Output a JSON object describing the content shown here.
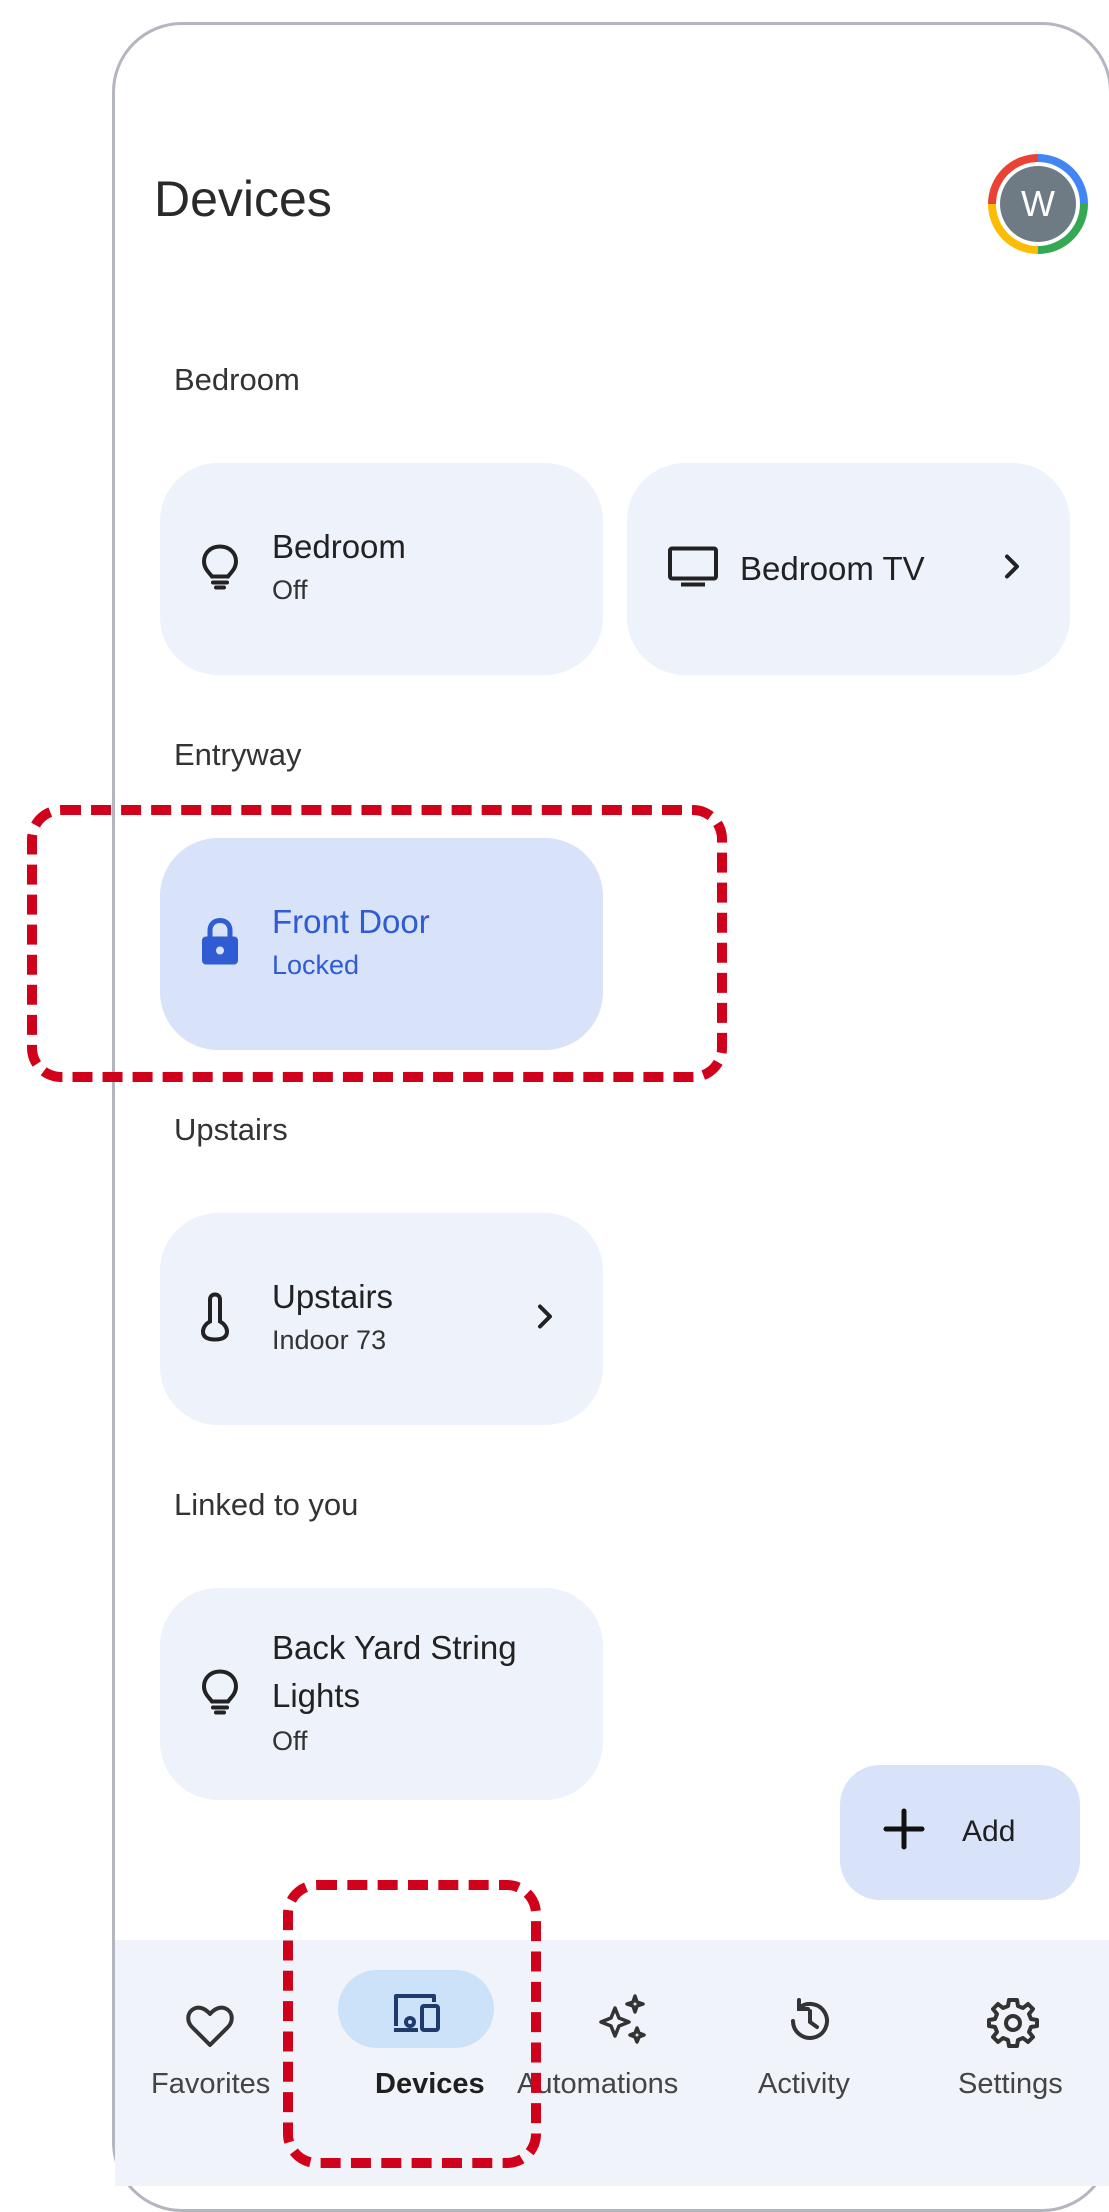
{
  "header": {
    "title": "Devices",
    "avatar_initial": "W"
  },
  "sections": {
    "bedroom": {
      "label": "Bedroom",
      "devices": [
        {
          "name": "Bedroom",
          "status": "Off",
          "icon": "lightbulb-icon"
        },
        {
          "name": "Bedroom TV",
          "status": "",
          "icon": "tv-icon",
          "chevron": true
        }
      ]
    },
    "entryway": {
      "label": "Entryway",
      "devices": [
        {
          "name": "Front Door",
          "status": "Locked",
          "icon": "lock-icon",
          "active": true
        }
      ]
    },
    "upstairs": {
      "label": "Upstairs",
      "devices": [
        {
          "name": "Upstairs",
          "status": "Indoor 73",
          "icon": "thermometer-icon",
          "chevron": true
        }
      ]
    },
    "linked": {
      "label": "Linked to you",
      "devices": [
        {
          "name": "Back Yard String Lights",
          "status": "Off",
          "icon": "lightbulb-icon"
        }
      ]
    }
  },
  "fab": {
    "label": "Add",
    "icon": "plus-icon"
  },
  "nav": {
    "items": [
      {
        "label": "Favorites",
        "icon": "heart-icon"
      },
      {
        "label": "Devices",
        "icon": "devices-icon",
        "selected": true
      },
      {
        "label": "Automations",
        "icon": "sparkle-icon"
      },
      {
        "label": "Activity",
        "icon": "history-icon"
      },
      {
        "label": "Settings",
        "icon": "gear-icon"
      }
    ]
  },
  "colors": {
    "accent": "#2f5bd3",
    "card": "#eef2fb",
    "card_active": "#d8e2f9",
    "nav_pill": "#cbe2f8",
    "annotation": "#d0021b"
  }
}
